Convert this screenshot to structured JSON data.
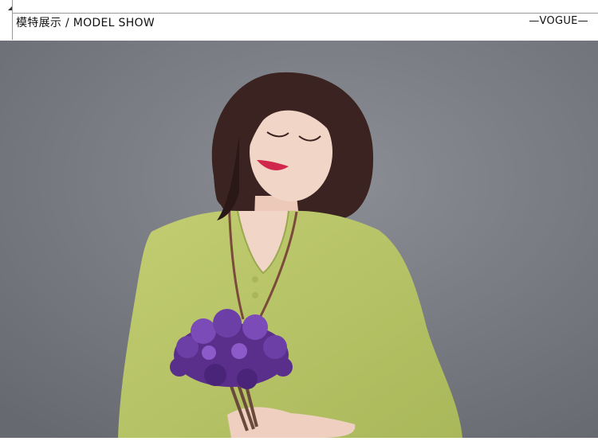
{
  "header": {
    "title_cn": "模特展示",
    "separator": " / ",
    "title_en": "MODEL SHOW",
    "tag": "—VOGUE—"
  },
  "photo": {
    "subject": "model-in-green-shirt-holding-purple-flowers",
    "colors": {
      "background": "#7b7f85",
      "shirt": "#bcc86a",
      "hair": "#3a2320",
      "skin": "#f1d6c8",
      "flowers": "#5a2f8c",
      "lips": "#d0284c"
    }
  }
}
